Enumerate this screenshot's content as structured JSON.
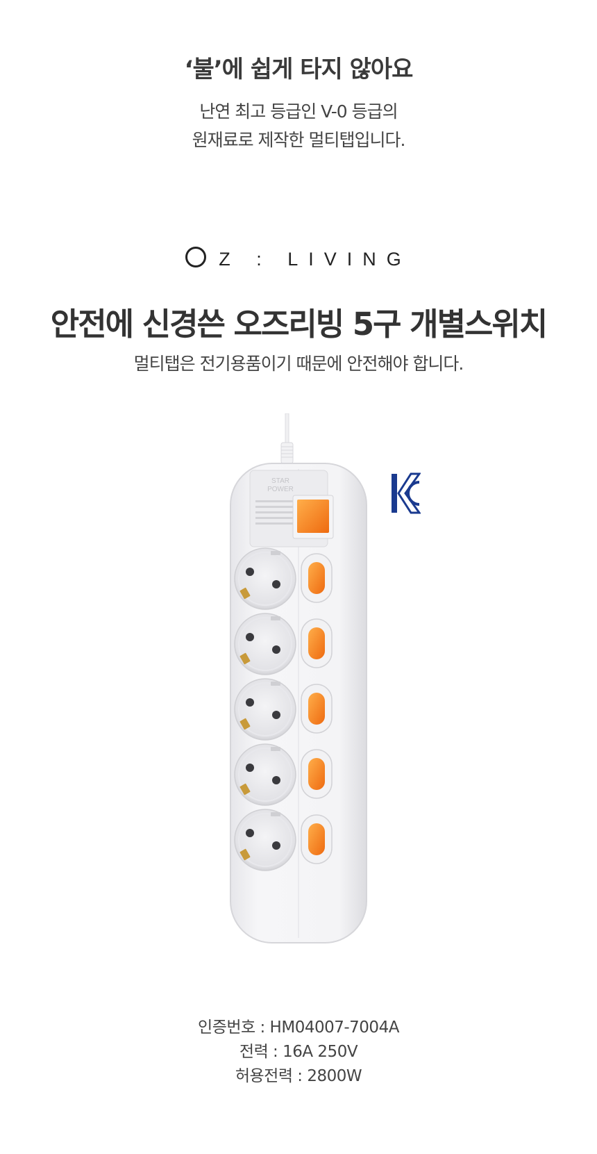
{
  "intro": {
    "headline": "‘불’에 쉽게 타지 않아요",
    "desc_line1": "난연 최고 등급인 V-0 등급의",
    "desc_line2": "원재료로 제작한 멀티탭입니다."
  },
  "brand": {
    "logo_rest": "Z : LIVING"
  },
  "product_section": {
    "title": "안전에 신경쓴 오즈리빙 5구 개별스위치",
    "subtitle": "멀티탭은 전기용품이기 때문에 안전해야 합니다."
  },
  "product_image": {
    "label_text_1": "STAR",
    "label_text_2": "POWER",
    "socket_count": 5,
    "body_color": "#f2f2f4",
    "switch_color": "#f47a1a",
    "icon": "power-strip-image"
  },
  "certification": {
    "icon": "kc-mark-icon",
    "color": "#1a3a8f"
  },
  "specs": {
    "cert_number": "인증번호 : HM04007-7004A",
    "power": "전력 : 16A 250V",
    "max_power": "허용전력 : 2800W"
  }
}
